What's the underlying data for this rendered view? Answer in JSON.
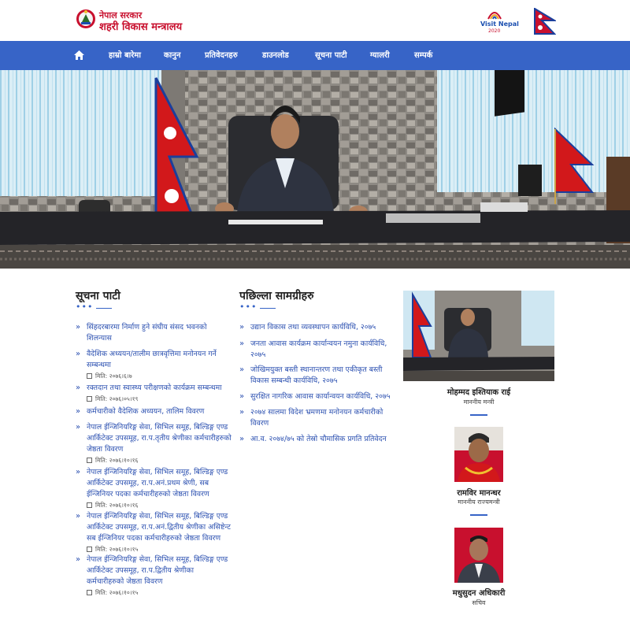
{
  "header": {
    "org_line1": "नेपाल सरकार",
    "org_line2": "शहरी विकास मन्त्रालय",
    "visit_text": "Visit Nepal",
    "visit_year": "2020"
  },
  "nav": {
    "items": [
      "हाम्रो बारेमा",
      "कानुन",
      "प्रतिवेदनहरु",
      "डाउनलोड",
      "सूचना पाटी",
      "ग्यालरी",
      "सम्पर्क"
    ]
  },
  "colors": {
    "nav_bg": "#3764c7",
    "link": "#2a4fb0",
    "nepal_red": "#c8102e"
  },
  "notice_board": {
    "title": "सूचना पाटी",
    "date_label": "मिति:",
    "items": [
      {
        "text": "सिंहदरबारमा निर्माण हुने संघीय संसद भवनको शिलन्यास",
        "date": ""
      },
      {
        "text": "वैदेशिक अध्ययन/तालीम छात्रवृत्तिमा मनोनयन गर्ने सम्बन्धमा",
        "date": "२०७६।६।७"
      },
      {
        "text": "रक्तदान तथा स्वास्थ्य परीक्षणको कार्यक्रम सम्बन्धमा",
        "date": "२०७६।०५।१९"
      },
      {
        "text": "कर्मचारीको वैदेशिक अध्ययन, तालिम विवरण",
        "date": ""
      },
      {
        "text": "नेपाल ईन्जिनियरिङ्ग सेवा, सिभिल समूह, बिल्डिङ्ग एण्ड आर्किटेक्ट उपसमूह, रा.प.तृतीय श्रेणीका कर्मचारीहरुको जेष्ठता विवरण",
        "date": "२०७६।१०।१६"
      },
      {
        "text": "नेपाल ईन्जिनियरिङ्ग सेवा, सिभिल समूह, बिल्डिङ्ग एण्ड आर्किटेक्ट उपसमूह, रा.प.अनं.प्रथम श्रेणी, सब ईन्जिनियर पदका कर्मचारीहरुको जेष्ठता विवरण",
        "date": "२०७६।१०।१६"
      },
      {
        "text": "नेपाल ईन्जिनियरिङ्ग सेवा, सिभिल समूह, बिल्डिङ्ग एण्ड आर्किटेक्ट उपसमूह, रा.प.अनं.द्वितीय श्रेणीका असिष्टेन्ट सब ईन्जिनियर पदका कर्मचारीहरुको जेष्ठता विवरण",
        "date": "२०७६।१०।१५"
      },
      {
        "text": "नेपाल ईन्जिनियरिङ्ग सेवा, सिभिल समूह, बिल्डिङ्ग एण्ड आर्किटेक्ट उपसमूह, रा.प.द्वितीय श्रेणीका कर्मचारीहरुको जेष्ठता विवरण",
        "date": "२०७६।१०।१५"
      }
    ]
  },
  "recent": {
    "title": "पछिल्ला सामग्रीहरु",
    "items": [
      "उद्यान विकास तथा व्यवस्थापन कार्यविधि, २०७५",
      "जनता आवास कार्यक्रम कार्यान्वयन नमुना कार्यविधि, २०७५",
      "जोखिमयुक्त बस्ती स्थानान्तरण तथा एकीकृत बस्ती विकास सम्बन्धी कार्यविधि, २०७५",
      "सुरक्षित नागरिक आवास कार्यान्वयन कार्यविधि, २०७५",
      "२०७४ सालमा विदेश भ्रमणमा मनोनयन कर्मचारीको विवरण",
      "आ.व. २०७४/७५ को तेस्रो चौमासिक प्रगति प्रतिवेदन"
    ]
  },
  "officials": [
    {
      "name": "मोहम्मद इश्तियाक राई",
      "role": "माननीय मन्त्री"
    },
    {
      "name": "रामविर मानन्धर",
      "role": "माननीय राज्यमन्त्री"
    },
    {
      "name": "मधुसुदन अधिकारी",
      "role": "सचिव"
    }
  ]
}
